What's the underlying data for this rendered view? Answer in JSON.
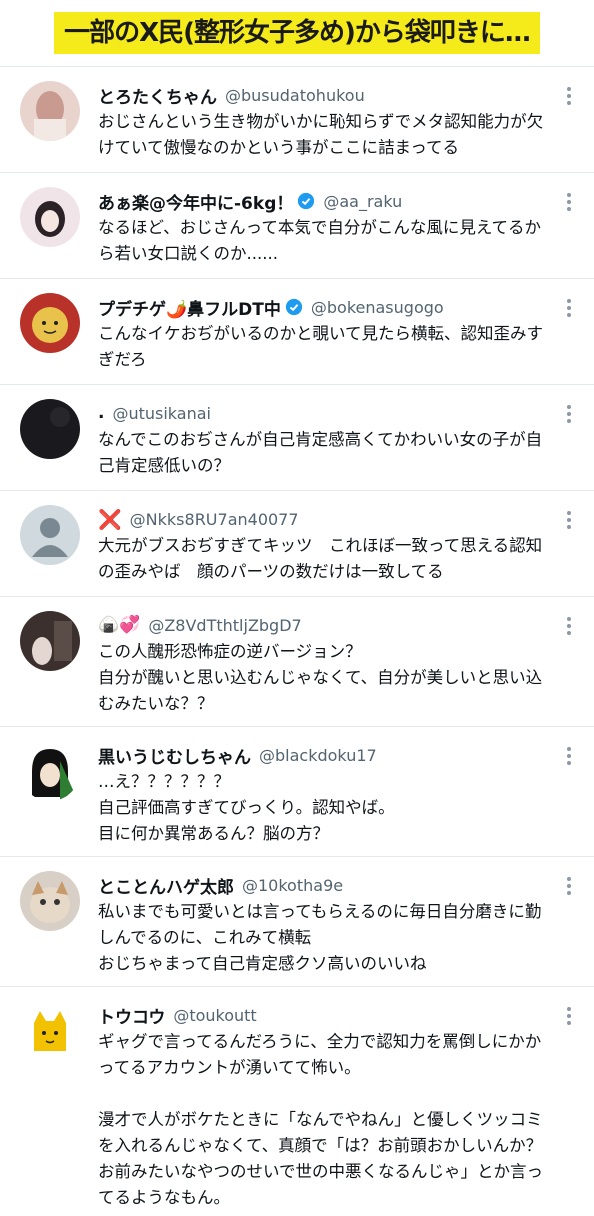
{
  "banner": {
    "text": "一部のX民(整形女子多め)から袋叩きに…"
  },
  "tweets": [
    {
      "name": "とろたくちゃん",
      "handle": "@busudatohukou",
      "verified": false,
      "text": "おじさんという生き物がいかに恥知らずでメタ認知能力が欠けていて傲慢なのかという事がここに詰まってる",
      "avatar_color": "#d9b8b0"
    },
    {
      "name": "あぁ楽@今年中に-6kg！",
      "handle": "@aa_raku",
      "verified": true,
      "text": "なるほど、おじさんって本気で自分がこんな風に見えてるから若い女口説くのか......",
      "avatar_color": "#e8d8dc"
    },
    {
      "name": "プデチゲ🌶️鼻フルDT中",
      "handle": "@bokenasugogo",
      "verified": true,
      "text": "こんなイケおぢがいるのかと覗いて見たら横転、認知歪みすぎだろ",
      "avatar_color": "#c0392b"
    },
    {
      "name": ".",
      "handle": "@utusikanai",
      "verified": false,
      "text": "なんでこのおぢさんが自己肯定感高くてかわいい女の子が自己肯定感低いの？",
      "avatar_color": "#1b1b1f"
    },
    {
      "name": "❌",
      "handle": "@Nkks8RU7an40077",
      "verified": false,
      "text": "大元がブスおぢすぎてキッツ　これほぼ一致って思える認知の歪みやば　顔のパーツの数だけは一致してる",
      "avatar_color": "#cfd9de"
    },
    {
      "name": "🍙💞",
      "handle": "@Z8VdTthtljZbgD7",
      "verified": false,
      "text": "この人醜形恐怖症の逆バージョン？\n自分が醜いと思い込むんじゃなくて、自分が美しいと思い込むみたいな？？",
      "avatar_color": "#4a3e3a"
    },
    {
      "name": "黒いうじむしちゃん",
      "handle": "@blackdoku17",
      "verified": false,
      "text": "…え？？？？？？\n自己評価高すぎてびっくり。認知やば。\n目に何か異常あるん？脳の方？",
      "avatar_color": "#2e7d32"
    },
    {
      "name": "とことんハゲ太郎",
      "handle": "@10kotha9e",
      "verified": false,
      "text": "私いまでも可愛いとは言ってもらえるのに毎日自分磨きに勤しんでるのに、これみて横転\nおじちゃまって自己肯定感クソ高いのいいね",
      "avatar_color": "#c9a27a"
    },
    {
      "name": "トウコウ",
      "handle": "@toukoutt",
      "verified": false,
      "text": "ギャグで言ってるんだろうに、全力で認知力を罵倒しにかかってるアカウントが湧いてて怖い。\n\n漫才で人がボケたときに「なんでやねん」と優しくツッコミを入れるんじゃなくて、真顔で「は？お前頭おかしいんか？お前みたいなやつのせいで世の中悪くなるんじゃ」とか言ってるようなもん。",
      "avatar_color": "#f2c200"
    }
  ]
}
